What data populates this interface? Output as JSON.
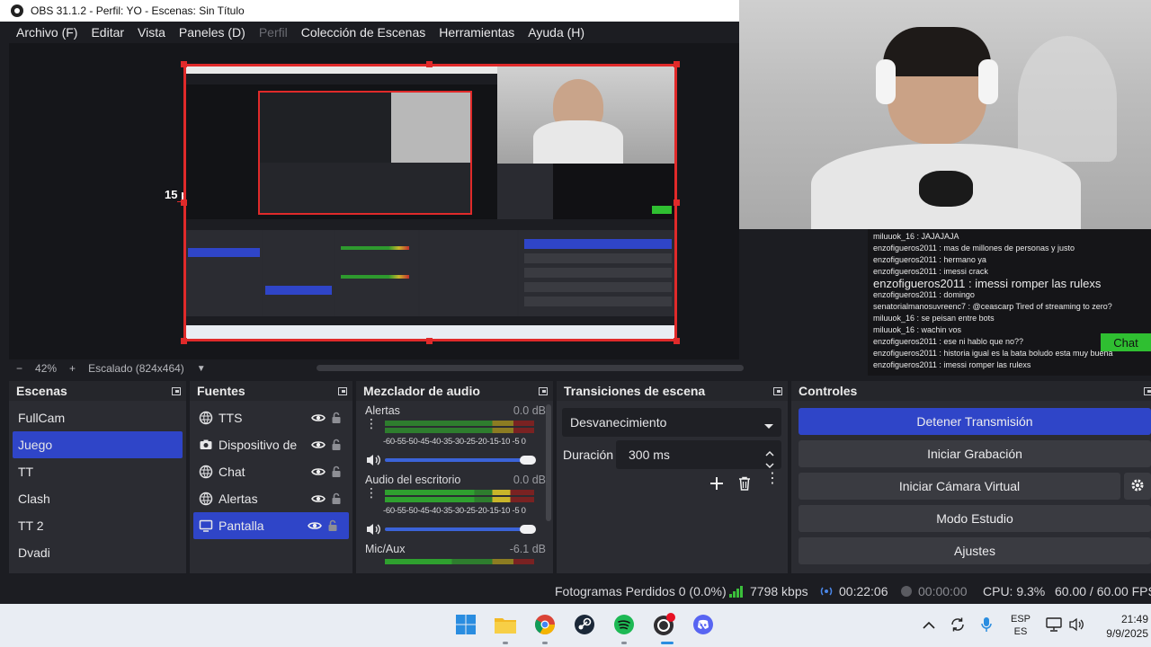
{
  "window": {
    "title": "OBS 31.1.2 - Perfil: YO - Escenas: Sin Título"
  },
  "menu": [
    "Archivo (F)",
    "Editar",
    "Vista",
    "Paneles (D)",
    "Perfil",
    "Colección de Escenas",
    "Herramientas",
    "Ayuda (H)"
  ],
  "preview": {
    "offset_label": "15 px",
    "zoom": "42%",
    "zoom_minus": "−",
    "zoom_plus": "+",
    "scale_label": "Escalado (824x464)"
  },
  "chat_overlay": {
    "lines": [
      "miluuok_16 : JAJAJAJA",
      "enzofigueros2011 : mas de millones de personas y justo",
      "enzofigueros2011 : hermano ya",
      "enzofigueros2011 : imessi crack",
      "enzofigueros2011 : imessi romper las rulexs",
      "enzofigueros2011 : domingo",
      "senatorialmanosuvreenc7 : @ceascarp Tired of streaming to zero?",
      "miluuok_16 : se peisan entre bots",
      "miluuok_16 : wachin vos",
      "enzofigueros2011 : ese ni hablo que no??",
      "enzofigueros2011 : historia igual es la bata boludo esta muy buena",
      "enzofigueros2011 : imessi romper las rulexs"
    ],
    "chat_button": "Chat"
  },
  "scenes": {
    "title": "Escenas",
    "items": [
      "FullCam",
      "Juego",
      "TT",
      "Clash",
      "TT 2",
      "Dvadi"
    ],
    "selected_index": 1
  },
  "sources": {
    "title": "Fuentes",
    "items": [
      {
        "label": "TTS",
        "icon": "globe-icon"
      },
      {
        "label": "Dispositivo de",
        "icon": "camera-icon"
      },
      {
        "label": "Chat",
        "icon": "globe-icon"
      },
      {
        "label": "Alertas",
        "icon": "globe-icon"
      },
      {
        "label": "Pantalla",
        "icon": "monitor-icon"
      }
    ],
    "selected_index": 4
  },
  "mixer": {
    "title": "Mezclador de audio",
    "ticks": "-60-55-50-45-40-35-30-25-20-15-10 -5  0",
    "channels": [
      {
        "name": "Alertas",
        "db": "0.0 dB"
      },
      {
        "name": "Audio del escritorio",
        "db": "0.0 dB"
      },
      {
        "name": "Mic/Aux",
        "db": "-6.1 dB"
      }
    ]
  },
  "transitions": {
    "title": "Transiciones de escena",
    "selected": "Desvanecimiento",
    "duration_label": "Duración",
    "duration_value": "300 ms"
  },
  "controls": {
    "title": "Controles",
    "buttons": [
      "Detener Transmisión",
      "Iniciar Grabación",
      "Iniciar Cámara Virtual",
      "Modo Estudio",
      "Ajustes"
    ]
  },
  "status": {
    "dropped": "Fotogramas Perdidos 0 (0.0%)",
    "bitrate": "7798 kbps",
    "stream_time": "00:22:06",
    "rec_time": "00:00:00",
    "cpu": "CPU: 9.3%",
    "fps": "60.00 / 60.00 FPS"
  },
  "taskbar": {
    "lang_top": "ESP",
    "lang_bottom": "ES",
    "time": "21:49",
    "date": "9/9/2025"
  },
  "colors": {
    "accent": "#2f45c8",
    "selection_border": "#e02a2a",
    "bg": "#1c1d22",
    "dock": "#2b2c32"
  }
}
